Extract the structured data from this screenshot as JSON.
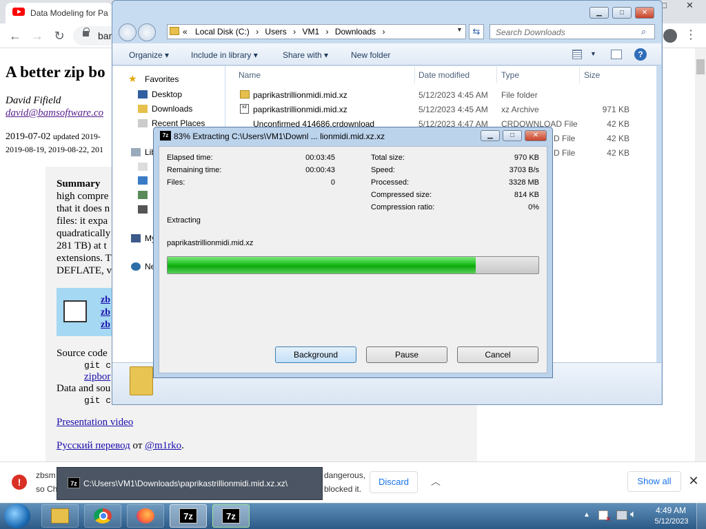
{
  "chrome": {
    "tab_title": "Data Modeling for Pa",
    "window_controls": [
      "−",
      "□",
      "✕"
    ],
    "omnibox_text": "bam",
    "page": {
      "heading": "A better zip bo",
      "author": "David Fifield",
      "email": "david@bamsoftware.co",
      "date_line1": "2019-07-02",
      "date_line1_small": "updated 2019-",
      "date_line2": "2019-08-19, 2019-08-22, 201",
      "summary_label": "Summary",
      "summary_lines": [
        "high compre",
        "that it does n",
        "files: it expa",
        "quadratically",
        "281 TB) at t",
        "extensions. T",
        "DEFLATE, v"
      ],
      "zblinks": [
        "zb",
        "zb",
        "zb"
      ],
      "source_code": "Source code",
      "git1": "git cl",
      "zipbomb_link": "zipbor",
      "data_and_source": "Data and sou",
      "git2": "git cl",
      "presentation_link": "Presentation video",
      "russian_link": "Русский перевод",
      "russian_from": "от",
      "russian_author": "@m1rko",
      "russian_end": "."
    },
    "download_bar": {
      "file_start": "zbsm",
      "file_line2": "so Ch",
      "warning_tail1": "dangerous,",
      "warning_tail2": "blocked it.",
      "discard": "Discard",
      "show_all": "Show all"
    }
  },
  "tooltip": {
    "text": "C:\\Users\\VM1\\Downloads\\paprikastrillionmidi.mid.xz.xz\\"
  },
  "explorer": {
    "breadcrumb_prefix": "«",
    "breadcrumb": [
      "Local Disk (C:)",
      "Users",
      "VM1",
      "Downloads"
    ],
    "search_placeholder": "Search Downloads",
    "commands": [
      "Organize",
      "Include in library",
      "Share with",
      "New folder"
    ],
    "nav": {
      "favorites": "Favorites",
      "desktop": "Desktop",
      "downloads": "Downloads",
      "recent": "Recent Places",
      "libraries": "Libi",
      "computer": "My",
      "network": "Ne"
    },
    "columns": [
      "Name",
      "Date modified",
      "Type",
      "Size"
    ],
    "files": [
      {
        "name": "paprikastrillionmidi.mid.xz",
        "date": "5/12/2023 4:45 AM",
        "type": "File folder",
        "size": ""
      },
      {
        "name": "paprikastrillionmidi.mid.xz",
        "date": "5/12/2023 4:45 AM",
        "type": "xz Archive",
        "size": "971 KB"
      },
      {
        "name": "Unconfirmed 414686.crdownload",
        "date": "5/12/2023 4:47 AM",
        "type": "CRDOWNLOAD File",
        "size": "42 KB"
      },
      {
        "name": "",
        "date": "",
        "type": "D File",
        "size": "42 KB"
      },
      {
        "name": "",
        "date": "",
        "type": "D File",
        "size": "42 KB"
      }
    ]
  },
  "zip": {
    "title": "83% Extracting C:\\Users\\VM1\\Downl ... lionmidi.mid.xz.xz",
    "left_stats": [
      {
        "label": "Elapsed time:",
        "value": "00:03:45"
      },
      {
        "label": "Remaining time:",
        "value": "00:00:43"
      },
      {
        "label": "Files:",
        "value": "0"
      }
    ],
    "right_stats": [
      {
        "label": "Total size:",
        "value": "970 KB"
      },
      {
        "label": "Speed:",
        "value": "3703 B/s"
      },
      {
        "label": "Processed:",
        "value": "3328 MB"
      },
      {
        "label": "Compressed size:",
        "value": "814 KB"
      },
      {
        "label": "Compression ratio:",
        "value": "0%"
      }
    ],
    "status": "Extracting",
    "current_file": "paprikastrillionmidi.mid.xz",
    "progress_fraction": 0.83,
    "buttons": [
      "Background",
      "Pause",
      "Cancel"
    ]
  },
  "taskbar": {
    "time": "4:49 AM",
    "date": "5/12/2023",
    "zip_icon_label": "7z"
  },
  "colors": {
    "progress_green": "#0ea70e",
    "explorer_frame": "#c8dcf1",
    "taskbar": "#2c5a87",
    "link": "#1a0dab"
  }
}
